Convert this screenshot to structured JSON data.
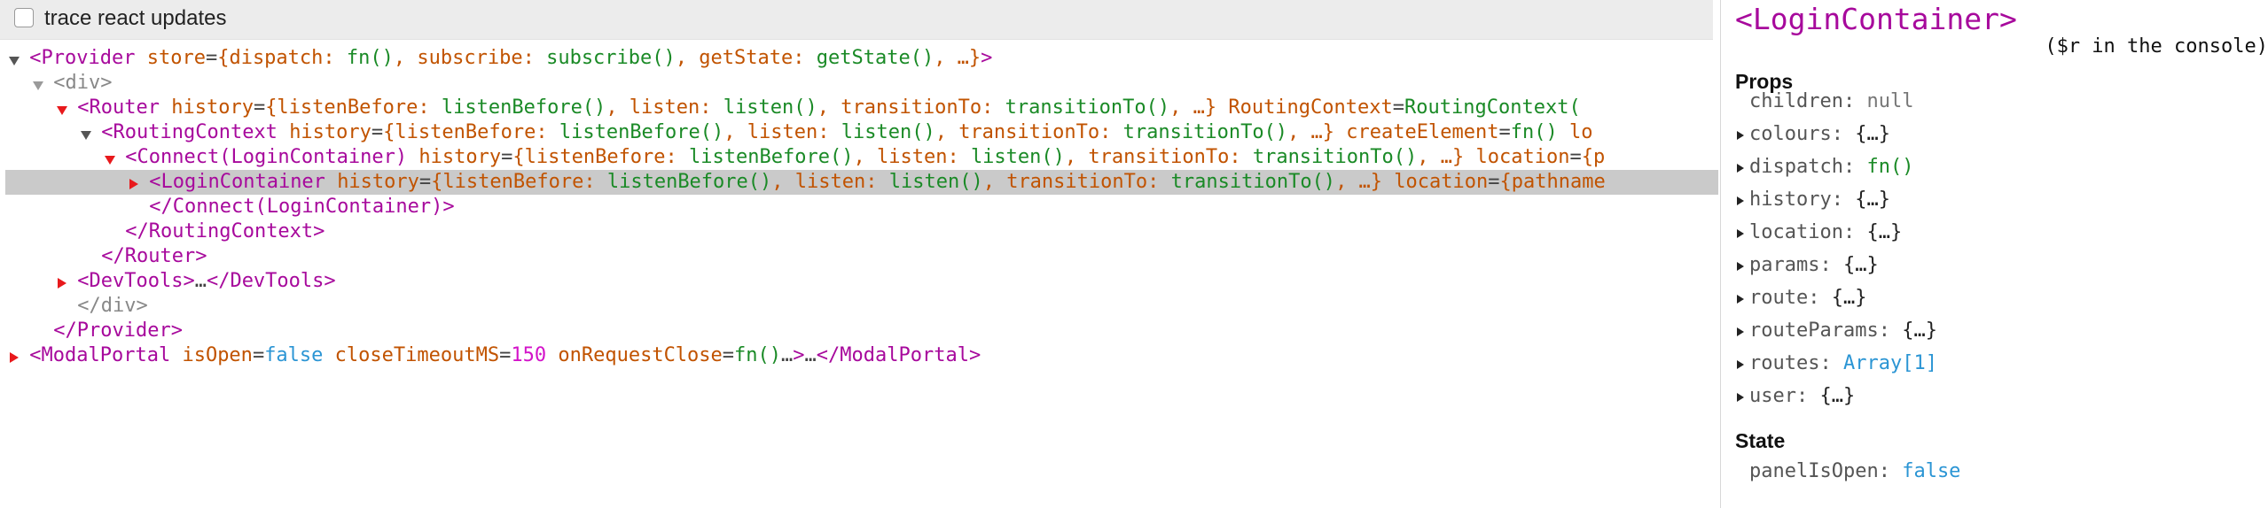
{
  "toolbar": {
    "trace_label": "trace react updates",
    "trace_checked": false
  },
  "tree": [
    {
      "indent": 0,
      "arrow": "down",
      "arrow_color": "dark",
      "selected": false,
      "tokens": [
        {
          "c": "tag",
          "t": "<Provider"
        },
        {
          "c": "sp",
          "t": " "
        },
        {
          "c": "attr",
          "t": "store"
        },
        {
          "c": "ellip",
          "t": "="
        },
        {
          "c": "attr",
          "t": "{dispatch: "
        },
        {
          "c": "val",
          "t": "fn()"
        },
        {
          "c": "attr",
          "t": ", subscribe: "
        },
        {
          "c": "val",
          "t": "subscribe()"
        },
        {
          "c": "attr",
          "t": ", getState: "
        },
        {
          "c": "val",
          "t": "getState()"
        },
        {
          "c": "attr",
          "t": ", …}"
        },
        {
          "c": "tag",
          "t": ">"
        }
      ]
    },
    {
      "indent": 1,
      "arrow": "down",
      "arrow_color": "gray",
      "selected": false,
      "tokens": [
        {
          "c": "tag-gray",
          "t": "<div>"
        }
      ]
    },
    {
      "indent": 2,
      "arrow": "down",
      "arrow_color": "red",
      "selected": false,
      "tokens": [
        {
          "c": "tag",
          "t": "<Router"
        },
        {
          "c": "sp",
          "t": " "
        },
        {
          "c": "attr",
          "t": "history"
        },
        {
          "c": "ellip",
          "t": "="
        },
        {
          "c": "attr",
          "t": "{listenBefore: "
        },
        {
          "c": "val",
          "t": "listenBefore()"
        },
        {
          "c": "attr",
          "t": ", listen: "
        },
        {
          "c": "val",
          "t": "listen()"
        },
        {
          "c": "attr",
          "t": ", transitionTo: "
        },
        {
          "c": "val",
          "t": "transitionTo()"
        },
        {
          "c": "attr",
          "t": ", …}"
        },
        {
          "c": "sp",
          "t": " "
        },
        {
          "c": "attr",
          "t": "RoutingContext"
        },
        {
          "c": "ellip",
          "t": "="
        },
        {
          "c": "val",
          "t": "RoutingContext("
        }
      ]
    },
    {
      "indent": 3,
      "arrow": "down",
      "arrow_color": "dark",
      "selected": false,
      "tokens": [
        {
          "c": "tag",
          "t": "<RoutingContext"
        },
        {
          "c": "sp",
          "t": " "
        },
        {
          "c": "attr",
          "t": "history"
        },
        {
          "c": "ellip",
          "t": "="
        },
        {
          "c": "attr",
          "t": "{listenBefore: "
        },
        {
          "c": "val",
          "t": "listenBefore()"
        },
        {
          "c": "attr",
          "t": ", listen: "
        },
        {
          "c": "val",
          "t": "listen()"
        },
        {
          "c": "attr",
          "t": ", transitionTo: "
        },
        {
          "c": "val",
          "t": "transitionTo()"
        },
        {
          "c": "attr",
          "t": ", …}"
        },
        {
          "c": "sp",
          "t": " "
        },
        {
          "c": "attr",
          "t": "createElement"
        },
        {
          "c": "ellip",
          "t": "="
        },
        {
          "c": "val",
          "t": "fn()"
        },
        {
          "c": "sp",
          "t": " "
        },
        {
          "c": "attr",
          "t": "lo"
        }
      ]
    },
    {
      "indent": 4,
      "arrow": "down",
      "arrow_color": "red",
      "selected": false,
      "tokens": [
        {
          "c": "tag",
          "t": "<Connect(LoginContainer)"
        },
        {
          "c": "sp",
          "t": " "
        },
        {
          "c": "attr",
          "t": "history"
        },
        {
          "c": "ellip",
          "t": "="
        },
        {
          "c": "attr",
          "t": "{listenBefore: "
        },
        {
          "c": "val",
          "t": "listenBefore()"
        },
        {
          "c": "attr",
          "t": ", listen: "
        },
        {
          "c": "val",
          "t": "listen()"
        },
        {
          "c": "attr",
          "t": ", transitionTo: "
        },
        {
          "c": "val",
          "t": "transitionTo()"
        },
        {
          "c": "attr",
          "t": ", …}"
        },
        {
          "c": "sp",
          "t": " "
        },
        {
          "c": "attr",
          "t": "location"
        },
        {
          "c": "ellip",
          "t": "="
        },
        {
          "c": "attr",
          "t": "{p"
        }
      ]
    },
    {
      "indent": 5,
      "arrow": "right",
      "arrow_color": "red",
      "selected": true,
      "tokens": [
        {
          "c": "tag",
          "t": "<LoginContainer"
        },
        {
          "c": "sp",
          "t": " "
        },
        {
          "c": "attr",
          "t": "history"
        },
        {
          "c": "ellip",
          "t": "="
        },
        {
          "c": "attr",
          "t": "{listenBefore: "
        },
        {
          "c": "val",
          "t": "listenBefore()"
        },
        {
          "c": "attr",
          "t": ", listen: "
        },
        {
          "c": "val",
          "t": "listen()"
        },
        {
          "c": "attr",
          "t": ", transitionTo: "
        },
        {
          "c": "val",
          "t": "transitionTo()"
        },
        {
          "c": "attr",
          "t": ", …}"
        },
        {
          "c": "sp",
          "t": " "
        },
        {
          "c": "attr",
          "t": "location"
        },
        {
          "c": "ellip",
          "t": "="
        },
        {
          "c": "attr",
          "t": "{pathname"
        }
      ]
    },
    {
      "indent": 5,
      "arrow": "none",
      "selected": false,
      "tokens": [
        {
          "c": "tag",
          "t": "</Connect(LoginContainer)>"
        }
      ]
    },
    {
      "indent": 4,
      "arrow": "none",
      "selected": false,
      "tokens": [
        {
          "c": "tag",
          "t": "</RoutingContext>"
        }
      ]
    },
    {
      "indent": 3,
      "arrow": "none",
      "selected": false,
      "tokens": [
        {
          "c": "tag",
          "t": "</Router>"
        }
      ]
    },
    {
      "indent": 2,
      "arrow": "right",
      "arrow_color": "red",
      "selected": false,
      "tokens": [
        {
          "c": "tag",
          "t": "<DevTools>"
        },
        {
          "c": "ellip",
          "t": "…"
        },
        {
          "c": "tag",
          "t": "</DevTools>"
        }
      ]
    },
    {
      "indent": 2,
      "arrow": "none",
      "selected": false,
      "tokens": [
        {
          "c": "tag-gray",
          "t": "</div>"
        }
      ]
    },
    {
      "indent": 1,
      "arrow": "none",
      "selected": false,
      "tokens": [
        {
          "c": "tag",
          "t": "</Provider>"
        }
      ]
    },
    {
      "indent": 0,
      "arrow": "right",
      "arrow_color": "red",
      "selected": false,
      "tokens": [
        {
          "c": "tag",
          "t": "<ModalPortal"
        },
        {
          "c": "sp",
          "t": " "
        },
        {
          "c": "attr",
          "t": "isOpen"
        },
        {
          "c": "ellip",
          "t": "="
        },
        {
          "c": "val-blue",
          "t": "false"
        },
        {
          "c": "sp",
          "t": " "
        },
        {
          "c": "attr",
          "t": "closeTimeoutMS"
        },
        {
          "c": "ellip",
          "t": "="
        },
        {
          "c": "val-num",
          "t": "150"
        },
        {
          "c": "sp",
          "t": " "
        },
        {
          "c": "attr",
          "t": "onRequestClose"
        },
        {
          "c": "ellip",
          "t": "="
        },
        {
          "c": "val",
          "t": "fn()"
        },
        {
          "c": "ellip",
          "t": "…"
        },
        {
          "c": "tag",
          "t": ">"
        },
        {
          "c": "ellip",
          "t": "…"
        },
        {
          "c": "tag",
          "t": "</ModalPortal>"
        }
      ]
    }
  ],
  "sidebar": {
    "title": "<LoginContainer>",
    "console_hint": "($r in the console)",
    "props_heading": "Props",
    "props": [
      {
        "key": "children",
        "value": "null",
        "style": "null",
        "expandable": false
      },
      {
        "key": "colours",
        "value": "{…}",
        "style": "plain",
        "expandable": true
      },
      {
        "key": "dispatch",
        "value": "fn()",
        "style": "green",
        "expandable": true
      },
      {
        "key": "history",
        "value": "{…}",
        "style": "plain",
        "expandable": true
      },
      {
        "key": "location",
        "value": "{…}",
        "style": "plain",
        "expandable": true
      },
      {
        "key": "params",
        "value": "{…}",
        "style": "plain",
        "expandable": true
      },
      {
        "key": "route",
        "value": "{…}",
        "style": "plain",
        "expandable": true
      },
      {
        "key": "routeParams",
        "value": "{…}",
        "style": "plain",
        "expandable": true
      },
      {
        "key": "routes",
        "value": "Array[1]",
        "style": "blue",
        "expandable": true
      },
      {
        "key": "user",
        "value": "{…}",
        "style": "plain",
        "expandable": true
      }
    ],
    "state_heading": "State",
    "state": [
      {
        "key": "panelIsOpen",
        "value": "false",
        "style": "blue",
        "expandable": false
      }
    ]
  },
  "colors": {
    "tag": "#a7099c",
    "attr": "#c15300",
    "value": "#1a8a26",
    "bool": "#2b95d4",
    "number": "#d313c9",
    "arrow": "#e8191c"
  }
}
